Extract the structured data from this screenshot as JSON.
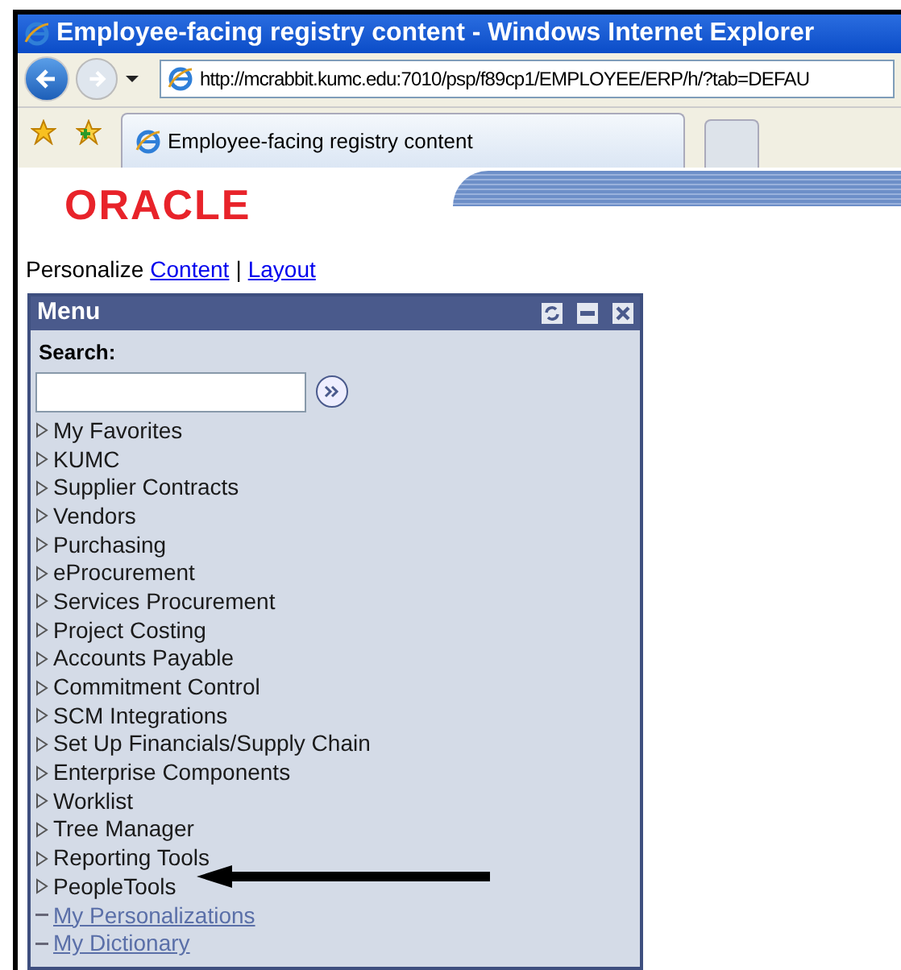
{
  "window": {
    "title": "Employee-facing registry content - Windows Internet Explorer"
  },
  "address_bar": {
    "url": "http://mcrabbit.kumc.edu:7010/psp/f89cp1/EMPLOYEE/ERP/h/?tab=DEFAU"
  },
  "tabs": [
    {
      "label": "Employee-facing registry content",
      "selected": true
    }
  ],
  "logo": {
    "text": "ORACLE"
  },
  "personalize": {
    "label": "Personalize",
    "links": [
      "Content",
      "Layout"
    ],
    "separator": "|"
  },
  "menu": {
    "title": "Menu",
    "search_label": "Search:",
    "items": [
      {
        "label": "My Favorites",
        "kind": "folder"
      },
      {
        "label": "KUMC",
        "kind": "folder"
      },
      {
        "label": "Supplier Contracts",
        "kind": "folder"
      },
      {
        "label": "Vendors",
        "kind": "folder"
      },
      {
        "label": "Purchasing",
        "kind": "folder"
      },
      {
        "label": "eProcurement",
        "kind": "folder"
      },
      {
        "label": "Services Procurement",
        "kind": "folder"
      },
      {
        "label": "Project Costing",
        "kind": "folder"
      },
      {
        "label": "Accounts Payable",
        "kind": "folder"
      },
      {
        "label": "Commitment Control",
        "kind": "folder"
      },
      {
        "label": "SCM Integrations",
        "kind": "folder"
      },
      {
        "label": "Set Up Financials/Supply Chain",
        "kind": "folder"
      },
      {
        "label": "Enterprise Components",
        "kind": "folder"
      },
      {
        "label": "Worklist",
        "kind": "folder"
      },
      {
        "label": "Tree Manager",
        "kind": "folder"
      },
      {
        "label": "Reporting Tools",
        "kind": "folder"
      },
      {
        "label": "PeopleTools",
        "kind": "folder"
      },
      {
        "label": "My Personalizations",
        "kind": "link"
      },
      {
        "label": "My Dictionary",
        "kind": "link"
      }
    ]
  }
}
